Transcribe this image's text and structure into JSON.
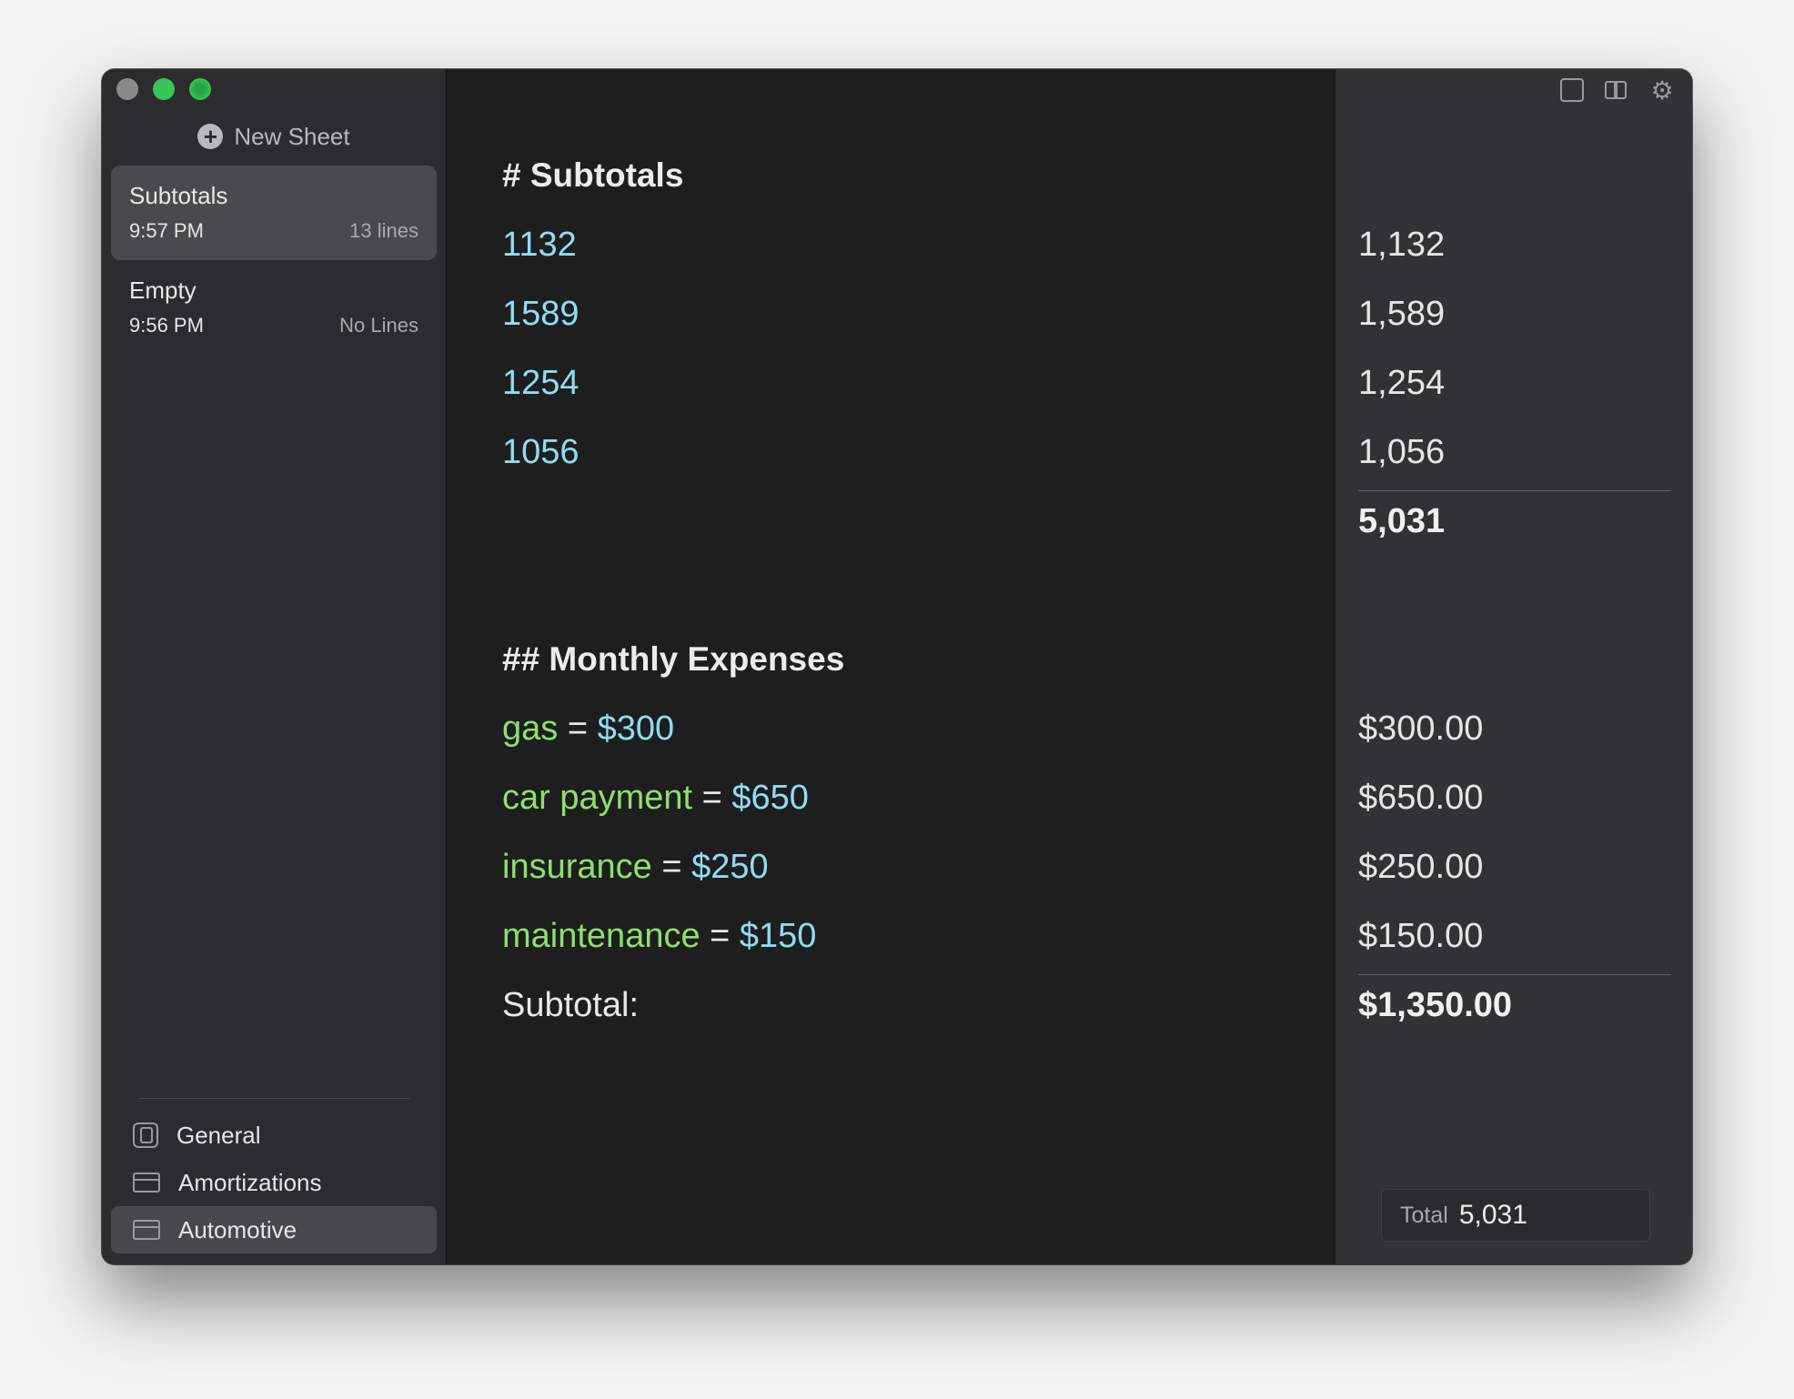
{
  "sidebar": {
    "new_sheet_label": "New Sheet",
    "sheets": [
      {
        "title": "Subtotals",
        "time": "9:57 PM",
        "lines": "13 lines",
        "selected": true
      },
      {
        "title": "Empty",
        "time": "9:56 PM",
        "lines": "No Lines",
        "selected": false
      }
    ],
    "folders": [
      {
        "label": "General",
        "icon": "general-icon"
      },
      {
        "label": "Amortizations",
        "icon": "folder-icon"
      },
      {
        "label": "Automotive",
        "icon": "folder-icon",
        "selected": true
      }
    ]
  },
  "editor": {
    "heading1": "# Subtotals",
    "numbers": [
      "1132",
      "1589",
      "1254",
      "1056"
    ],
    "heading2": "## Monthly Expenses",
    "expenses": [
      {
        "name": "gas",
        "op": " = ",
        "value": "$300"
      },
      {
        "name": "car payment",
        "op": " = ",
        "value": "$650"
      },
      {
        "name": "insurance",
        "op": " = ",
        "value": "$250"
      },
      {
        "name": "maintenance",
        "op": " = ",
        "value": "$150"
      }
    ],
    "subtotal_label": "Subtotal:"
  },
  "results": {
    "numbers": [
      "1,132",
      "1,589",
      "1,254",
      "1,056"
    ],
    "numbers_subtotal": "5,031",
    "expenses": [
      "$300.00",
      "$650.00",
      "$250.00",
      "$150.00"
    ],
    "expenses_subtotal": "$1,350.00",
    "total_label": "Total",
    "total_value": "5,031"
  },
  "toolbar": {
    "icons": [
      "sidebar-toggle-icon",
      "book-icon",
      "gear-icon"
    ]
  },
  "colors": {
    "number": "#8fdcf2",
    "variable": "#8ce06e",
    "editor_bg": "#1e1e1e",
    "results_bg": "#323234",
    "sidebar_bg": "#2c2c2f"
  }
}
